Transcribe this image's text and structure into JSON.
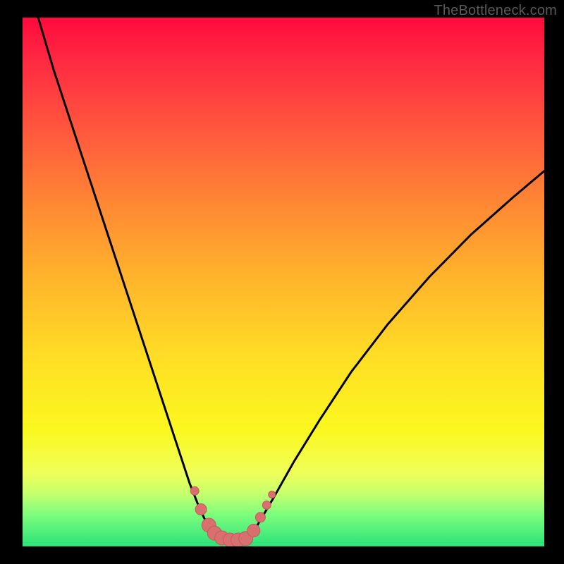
{
  "watermark": "TheBottleneck.com",
  "colors": {
    "background": "#000000",
    "curve_stroke": "#000000",
    "marker_fill": "#d7706f",
    "marker_stroke": "#c55a59"
  },
  "chart_data": {
    "type": "line",
    "title": "",
    "xlabel": "",
    "ylabel": "",
    "xlim": [
      0,
      100
    ],
    "ylim": [
      0,
      100
    ],
    "grid": false,
    "series": [
      {
        "name": "left-curve",
        "x": [
          3,
          6,
          10,
          14,
          18,
          22,
          25,
          28,
          30,
          32,
          34,
          35.5,
          36.5,
          37.5
        ],
        "y": [
          100,
          90,
          78,
          66,
          54,
          42,
          33,
          24,
          18,
          12,
          7,
          4,
          2.5,
          1.8
        ]
      },
      {
        "name": "floor",
        "x": [
          37.5,
          39,
          41,
          43
        ],
        "y": [
          1.8,
          1.2,
          1.2,
          1.6
        ]
      },
      {
        "name": "right-curve",
        "x": [
          43,
          45,
          48,
          52,
          57,
          63,
          70,
          78,
          86,
          94,
          100
        ],
        "y": [
          1.6,
          4,
          9,
          16,
          24,
          33,
          42,
          51,
          59,
          66,
          71
        ]
      }
    ],
    "annotations": {
      "markers": [
        {
          "x": 33.0,
          "y": 10.5,
          "r": 6
        },
        {
          "x": 34.2,
          "y": 7.0,
          "r": 8
        },
        {
          "x": 35.7,
          "y": 4.0,
          "r": 10
        },
        {
          "x": 36.8,
          "y": 2.5,
          "r": 10
        },
        {
          "x": 38.2,
          "y": 1.6,
          "r": 10
        },
        {
          "x": 39.8,
          "y": 1.2,
          "r": 10
        },
        {
          "x": 41.3,
          "y": 1.2,
          "r": 10
        },
        {
          "x": 42.8,
          "y": 1.5,
          "r": 10
        },
        {
          "x": 44.3,
          "y": 3.0,
          "r": 9
        },
        {
          "x": 45.6,
          "y": 5.5,
          "r": 7
        },
        {
          "x": 46.8,
          "y": 7.8,
          "r": 6
        },
        {
          "x": 47.8,
          "y": 9.8,
          "r": 5
        }
      ]
    }
  }
}
